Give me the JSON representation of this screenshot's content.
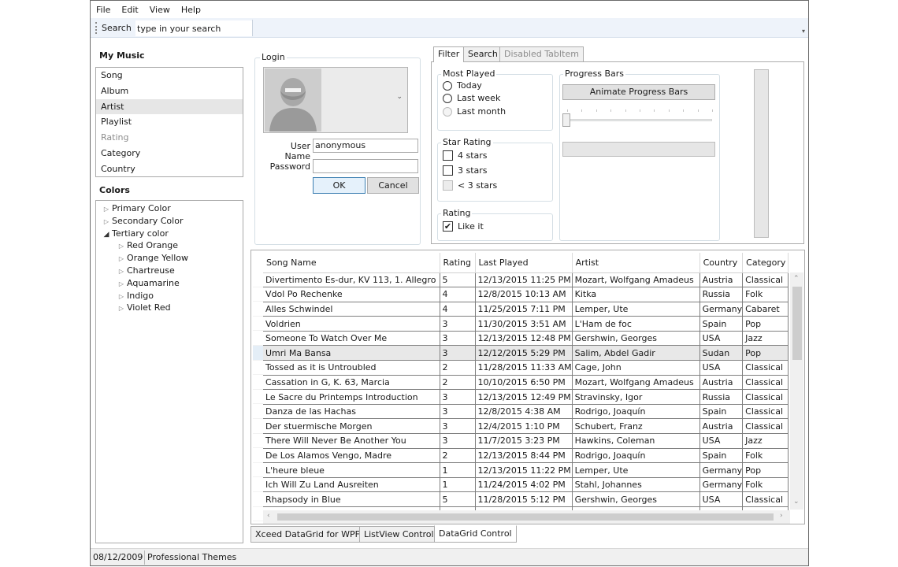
{
  "menu": {
    "items": [
      "File",
      "Edit",
      "View",
      "Help"
    ]
  },
  "toolbar": {
    "search_label": "Search",
    "search_placeholder": "type in your search"
  },
  "my_music": {
    "title": "My Music",
    "items": [
      {
        "label": "Song",
        "state": "normal"
      },
      {
        "label": "Album",
        "state": "normal"
      },
      {
        "label": "Artist",
        "state": "selected"
      },
      {
        "label": "Playlist",
        "state": "normal"
      },
      {
        "label": "Rating",
        "state": "disabled"
      },
      {
        "label": "Category",
        "state": "normal"
      },
      {
        "label": "Country",
        "state": "normal"
      }
    ]
  },
  "colors": {
    "title": "Colors",
    "tree": [
      {
        "label": "Primary Color",
        "depth": 0,
        "expanded": false
      },
      {
        "label": "Secondary Color",
        "depth": 0,
        "expanded": false
      },
      {
        "label": "Tertiary color",
        "depth": 0,
        "expanded": true
      },
      {
        "label": "Red Orange",
        "depth": 1,
        "expanded": false
      },
      {
        "label": "Orange Yellow",
        "depth": 1,
        "expanded": false
      },
      {
        "label": "Chartreuse",
        "depth": 1,
        "expanded": false
      },
      {
        "label": "Aquamarine",
        "depth": 1,
        "expanded": false
      },
      {
        "label": "Indigo",
        "depth": 1,
        "expanded": false
      },
      {
        "label": "Violet Red",
        "depth": 1,
        "expanded": false
      }
    ]
  },
  "login": {
    "title": "Login",
    "user_name_label": "User Name",
    "user_name_value": "anonymous",
    "password_label": "Password",
    "password_value": "",
    "ok_label": "OK",
    "cancel_label": "Cancel"
  },
  "tabs": [
    {
      "label": "Filter",
      "state": "active"
    },
    {
      "label": "Search",
      "state": "normal"
    },
    {
      "label": "Disabled TabItem",
      "state": "disabled"
    }
  ],
  "filter": {
    "most_played": {
      "title": "Most Played",
      "options": [
        {
          "label": "Today",
          "disabled": false
        },
        {
          "label": "Last week",
          "disabled": false
        },
        {
          "label": "Last month",
          "disabled": true
        }
      ]
    },
    "star_rating": {
      "title": "Star Rating",
      "options": [
        {
          "label": "4 stars",
          "checked": false,
          "disabled": false
        },
        {
          "label": "3 stars",
          "checked": false,
          "disabled": false
        },
        {
          "label": "< 3 stars",
          "checked": false,
          "disabled": true
        }
      ]
    },
    "rating": {
      "title": "Rating",
      "like_label": "Like it",
      "like_checked": true
    },
    "progress_bars": {
      "title": "Progress Bars",
      "animate_label": "Animate Progress Bars",
      "slider_value": 0,
      "progress_value": 0
    }
  },
  "grid": {
    "columns": [
      "Song Name",
      "Rating",
      "Last Played",
      "Artist",
      "Country",
      "Category"
    ],
    "selected_row": 5,
    "rows": [
      [
        "Divertimento Es-dur, KV 113, 1. Allegro",
        "5",
        "12/13/2015 11:25 PM",
        "Mozart, Wolfgang Amadeus",
        "Austria",
        "Classical"
      ],
      [
        "Vdol Po Rechenke",
        "4",
        "12/8/2015 10:13 AM",
        "Kitka",
        "Russia",
        "Folk"
      ],
      [
        "Alles Schwindel",
        "4",
        "11/25/2015 7:11 PM",
        "Lemper, Ute",
        "Germany",
        "Cabaret"
      ],
      [
        "Voldrien",
        "3",
        "11/30/2015 3:51 AM",
        "L'Ham de foc",
        "Spain",
        "Pop"
      ],
      [
        "Someone To Watch Over Me",
        "3",
        "12/13/2015 12:48 PM",
        "Gershwin, Georges",
        "USA",
        "Jazz"
      ],
      [
        "Umri Ma Bansa",
        "3",
        "12/12/2015 5:29 PM",
        "Salim, Abdel Gadir",
        "Sudan",
        "Pop"
      ],
      [
        "Tossed as it is Untroubled",
        "2",
        "11/28/2015 11:33 AM",
        "Cage, John",
        "USA",
        "Classical"
      ],
      [
        "Cassation in G, K. 63, Marcia",
        "2",
        "10/10/2015 6:50 PM",
        "Mozart, Wolfgang Amadeus",
        "Austria",
        "Classical"
      ],
      [
        "Le Sacre du Printemps Introduction",
        "3",
        "12/13/2015 12:49 PM",
        "Stravinsky, Igor",
        "Russia",
        "Classical"
      ],
      [
        "Danza de las Hachas",
        "3",
        "12/8/2015 4:38 AM",
        "Rodrigo, Joaquín",
        "Spain",
        "Classical"
      ],
      [
        "Der stuermische Morgen",
        "3",
        "12/4/2015 1:10 PM",
        "Schubert, Franz",
        "Austria",
        "Classical"
      ],
      [
        "There Will Never Be Another You",
        "3",
        "11/7/2015 3:23 PM",
        "Hawkins, Coleman",
        "USA",
        "Jazz"
      ],
      [
        "De Los Alamos Vengo, Madre",
        "2",
        "12/13/2015 8:44 PM",
        "Rodrigo, Joaquín",
        "Spain",
        "Folk"
      ],
      [
        "L'heure bleue",
        "1",
        "12/13/2015 11:22 PM",
        "Lemper, Ute",
        "Germany",
        "Pop"
      ],
      [
        "Ich Will Zu Land Ausreiten",
        "1",
        "11/24/2015 4:02 PM",
        "Stahl, Johannes",
        "Germany",
        "Folk"
      ],
      [
        "Rhapsody in Blue",
        "5",
        "11/28/2015 5:12 PM",
        "Gershwin, Georges",
        "USA",
        "Classical"
      ],
      [
        "",
        "",
        "",
        "",
        "",
        ""
      ]
    ]
  },
  "bottom_tabs": [
    {
      "label": "Xceed DataGrid for WPF",
      "state": "normal"
    },
    {
      "label": "ListView Control",
      "state": "normal"
    },
    {
      "label": "DataGrid Control",
      "state": "active"
    }
  ],
  "status": {
    "date": "08/12/2009",
    "theme": "Professional Themes"
  }
}
